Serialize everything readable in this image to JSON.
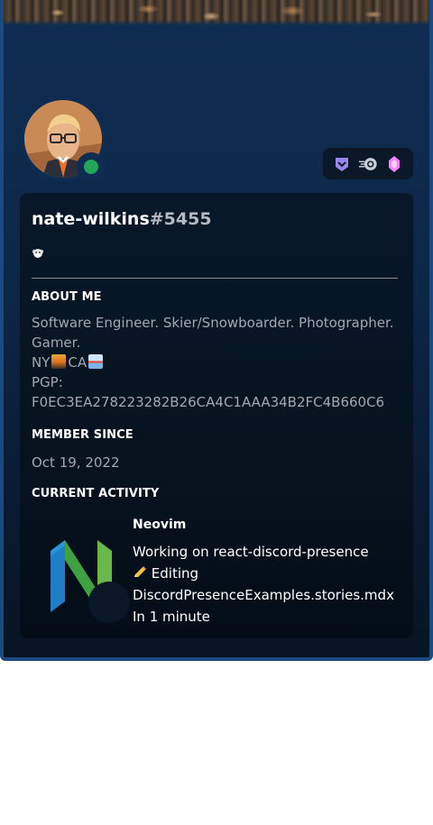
{
  "profile": {
    "username": "nate-wilkins",
    "discriminator": "#5455",
    "status": "online",
    "status_color": "#23a55a",
    "custom_status_icon": "monkey-emoji-icon"
  },
  "badges": [
    {
      "icon": "hypesquad-badge-icon",
      "color": "#9b84ec"
    },
    {
      "icon": "nitro-badge-icon",
      "color": "#c9cdd4"
    },
    {
      "icon": "boost-gem-badge-icon",
      "color": "#f47fff"
    }
  ],
  "about": {
    "title": "ABOUT ME",
    "line1": "Software Engineer. Skier/Snowboarder. Photographer.",
    "line2": "Gamer.",
    "location_ny": "NY",
    "location_ca": "CA",
    "pgp_label": "PGP:",
    "pgp_key": "F0EC3EA278223282B26CA4C1AAA34B2FC4B660C6"
  },
  "member_since": {
    "title": "MEMBER SINCE",
    "date": "Oct 19, 2022"
  },
  "activity": {
    "title": "CURRENT ACTIVITY",
    "name": "Neovim",
    "details": "Working on react-discord-presence",
    "state_prefix": "Editing",
    "state_file": "DiscordPresenceExamples.stories.mdx",
    "time": "In 1 minute",
    "large_image_icon": "neovim-logo-icon"
  },
  "colors": {
    "card_border": "#1a4a80",
    "card_bg": "#0f2d52",
    "panel_bg": "#08182a"
  }
}
